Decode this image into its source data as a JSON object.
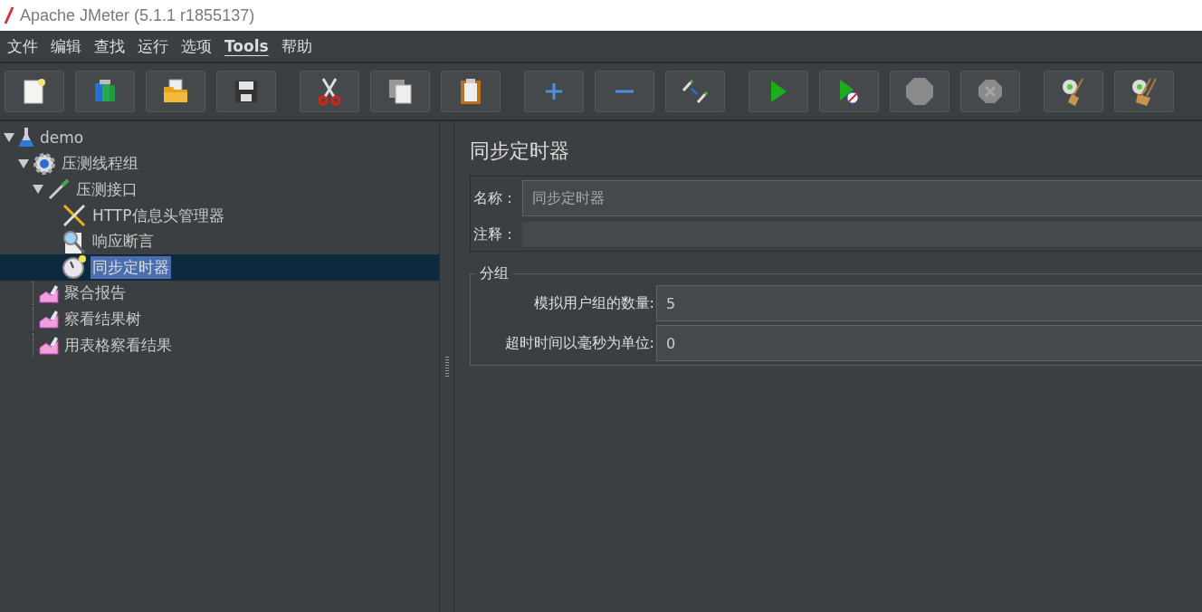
{
  "window": {
    "title": "Apache JMeter (5.1.1 r1855137)"
  },
  "menu": [
    {
      "label": "文件",
      "mnemonic": false
    },
    {
      "label": "编辑",
      "mnemonic": false
    },
    {
      "label": "查找",
      "mnemonic": false
    },
    {
      "label": "运行",
      "mnemonic": false
    },
    {
      "label": "选项",
      "mnemonic": false
    },
    {
      "label": "Tools",
      "mnemonic": true
    },
    {
      "label": "帮助",
      "mnemonic": false
    }
  ],
  "toolbar": {
    "groups": [
      [
        {
          "kind": "new"
        },
        {
          "kind": "templates"
        },
        {
          "kind": "open"
        },
        {
          "kind": "save"
        }
      ],
      [
        {
          "kind": "cut"
        },
        {
          "kind": "copy"
        },
        {
          "kind": "paste"
        }
      ],
      [
        {
          "kind": "expand"
        },
        {
          "kind": "collapse"
        },
        {
          "kind": "toggle"
        }
      ],
      [
        {
          "kind": "start"
        },
        {
          "kind": "start-no-timers"
        },
        {
          "kind": "stop"
        },
        {
          "kind": "shutdown"
        }
      ],
      [
        {
          "kind": "clear"
        },
        {
          "kind": "clear-all"
        }
      ]
    ]
  },
  "tree": [
    {
      "label": "demo",
      "kind": "test-plan",
      "expanded": true,
      "selected": false,
      "children": [
        {
          "label": "压测线程组",
          "kind": "thread-group",
          "expanded": true,
          "selected": false,
          "children": [
            {
              "label": "压测接口",
              "kind": "sampler",
              "expanded": true,
              "selected": false,
              "children": [
                {
                  "label": "HTTP信息头管理器",
                  "kind": "config",
                  "selected": false
                },
                {
                  "label": "响应断言",
                  "kind": "assertion",
                  "selected": false
                },
                {
                  "label": "同步定时器",
                  "kind": "timer",
                  "selected": true
                }
              ]
            },
            {
              "label": "聚合报告",
              "kind": "listener",
              "selected": false
            },
            {
              "label": "察看结果树",
              "kind": "listener",
              "selected": false
            },
            {
              "label": "用表格察看结果",
              "kind": "listener",
              "selected": false
            }
          ]
        }
      ]
    }
  ],
  "panel": {
    "title": "同步定时器",
    "name_label": "名称：",
    "name_value": "同步定时器",
    "comment_label": "注释：",
    "group": {
      "title": "分组",
      "fields": [
        {
          "label": "模拟用户组的数量:",
          "value": "5"
        },
        {
          "label": "超时时间以毫秒为单位:",
          "value": "0"
        }
      ]
    }
  }
}
